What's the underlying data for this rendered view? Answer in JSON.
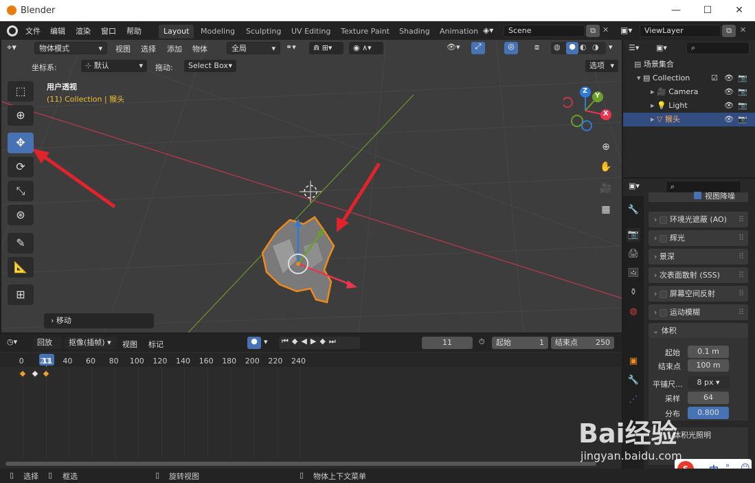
{
  "window": {
    "title": "Blender",
    "minimize": "—",
    "maximize": "☐",
    "close": "✕"
  },
  "menu": {
    "items": [
      "文件",
      "编辑",
      "渲染",
      "窗口",
      "帮助"
    ]
  },
  "workspaces": [
    "Layout",
    "Modeling",
    "Sculpting",
    "UV Editing",
    "Texture Paint",
    "Shading",
    "Animation"
  ],
  "scene": "Scene",
  "view_layer": "ViewLayer",
  "viewport": {
    "mode": "物体模式",
    "menus": [
      "视图",
      "选择",
      "添加",
      "物体"
    ],
    "transform_space": "全局",
    "coord_label": "坐标系:",
    "coord_value": "默认",
    "drag_label": "拖动:",
    "drag_value": "Select Box",
    "options": "选项",
    "view_name": "用户透视",
    "collection_info": "(11) Collection | 猴头",
    "last_op": "移动",
    "gizmo": {
      "x": "X",
      "y": "Y",
      "z": "Z"
    },
    "colors": {
      "x": "#e8364e",
      "y": "#6aa02a",
      "z": "#2f7ad8",
      "selection": "#f08a1c",
      "accent": "#4772b3"
    }
  },
  "timeline": {
    "menus": [
      "回放",
      "抠像(插帧)",
      "视图",
      "标记"
    ],
    "current_frame": "11",
    "start_label": "起始",
    "start": "1",
    "end_label": "结束点",
    "end": "250",
    "ticks": [
      "0",
      "20",
      "40",
      "60",
      "80",
      "100",
      "120",
      "140",
      "160",
      "180",
      "200",
      "220",
      "240"
    ],
    "keyframes": [
      0,
      11,
      20
    ]
  },
  "outliner": {
    "root": "场景集合",
    "collection": "Collection",
    "items": [
      {
        "name": "Camera"
      },
      {
        "name": "Light"
      },
      {
        "name": "猴头",
        "selected": true
      }
    ]
  },
  "properties": {
    "top_item": "视图降噪",
    "panels": [
      "环境光遮蔽 (AO)",
      "辉光",
      "景深",
      "次表面散射 (SSS)",
      "屏幕空间反射",
      "运动模糊"
    ],
    "volume": {
      "title": "体积",
      "start_label": "起始",
      "start": "0.1 m",
      "end_label": "结束点",
      "end": "100 m",
      "tile_label": "平铺尺...",
      "tile": "8 px",
      "samples_label": "采样",
      "samples": "64",
      "dist_label": "分布",
      "dist": "0.800",
      "lighting_label": "体积光照明"
    }
  },
  "statusbar": {
    "items": [
      "选择",
      "框选",
      "旋转视图",
      "物体上下文菜单"
    ]
  },
  "watermark": {
    "text": "Bai经验",
    "url": "jingyan.baidu.com"
  },
  "ime": {
    "lang": "中"
  }
}
